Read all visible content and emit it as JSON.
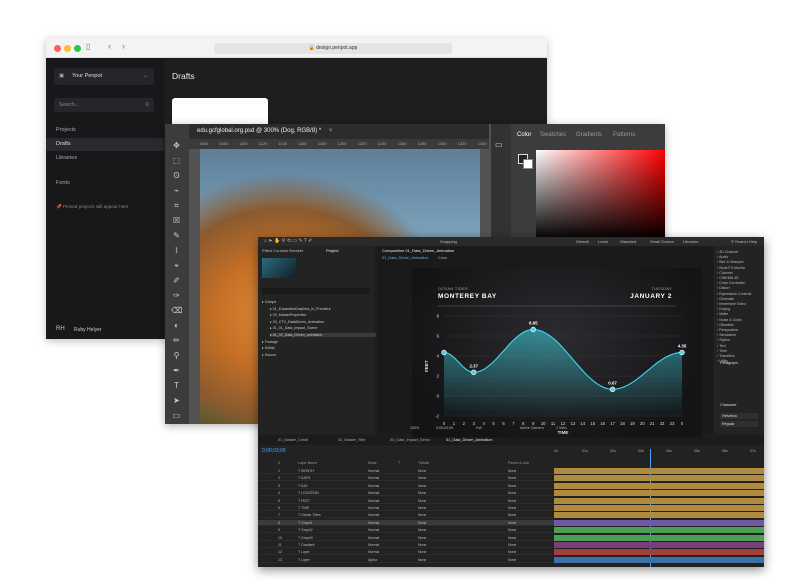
{
  "penpot": {
    "url": "design.penpot.app",
    "team": "Your Penpot",
    "search_placeholder": "Search...",
    "nav": [
      "Projects",
      "Drafts",
      "Libraries",
      "Fonts"
    ],
    "pinned_note": "Pinned projects will appear here",
    "user_initials": "RH",
    "user_name": "Ruby Helyer",
    "title": "Drafts"
  },
  "photoshop": {
    "doc_tab": "edu.gcfglobal.org.psd @ 300% (Dog, RGB/8) *",
    "ruler": "1060 1080 1100 1120 1140 1160 1180 1200 1220 1240 1260 1280 1300 1320 1340 1360",
    "panel_tabs": [
      "Color",
      "Swatches",
      "Gradients",
      "Patterns"
    ],
    "tools": [
      "✥",
      "⬚",
      "ʘ",
      "⌁",
      "⌗",
      "☒",
      "✎",
      "⌇",
      "⌖",
      "✐",
      "✑",
      "⌫",
      "◐",
      "✏",
      "⚲",
      "✒",
      "T",
      "➤",
      "▭"
    ]
  },
  "after_effects": {
    "menu": [
      "Snapping",
      "Default",
      "Learn",
      "Standard",
      "Small Screen",
      "Libraries"
    ],
    "search_help": "Search Help",
    "project_tab": "Project",
    "effect_controls": "Effect Controls Breaker",
    "comp_tab": "Composition 01_Data_Driven_Animation",
    "comp_breadcrumb": "01_Data_Driven_Animation",
    "comp_sub": "Color",
    "project_items": [
      "Comps",
      "01_ExpandedGraphics_in_Premiere",
      "02_MasterProperties",
      "03_CTV_DataDriven_Animation",
      "01_01_Data_Impact_Scene",
      "01_02_Data_Driven_animation",
      "Footage",
      "Solids",
      "Source"
    ],
    "effects_list": [
      "3D Channel",
      "Audio",
      "Blur & Sharpen",
      "Boris FX Mocha",
      "Channel",
      "CINEMA 4D",
      "Color Correction",
      "Distort",
      "Expression Controls",
      "Generate",
      "Immersive Video",
      "Keying",
      "Matte",
      "Noise & Grain",
      "Obsolete",
      "Perspective",
      "Simulation",
      "Stylize",
      "Text",
      "Time",
      "Transition",
      "Utility"
    ],
    "paragraph_label": "Paragraph",
    "character_label": "Character",
    "font_name": "Helvetica",
    "font_style": "Regular",
    "viewer_zoom": "100%",
    "viewer_time": "0;00;03;09",
    "viewer_quality": "Full",
    "viewer_camera": "Active Camera",
    "viewer_view": "1 View",
    "timecode": "0;00;03;09",
    "timeline_tabs": [
      "01_Master_Credit",
      "02_Master_Title",
      "03_Data_Impact_Demo",
      "01_Data_Driven_Animation"
    ],
    "layer_headers": [
      "#",
      "Layer Name",
      "Mode",
      "T",
      "TrkMat",
      "Parent & Link"
    ],
    "layers": [
      {
        "num": "1",
        "name": "MONTH",
        "mode": "Normal",
        "parent": "None"
      },
      {
        "num": "2",
        "name": "DAYS",
        "mode": "Normal",
        "parent": "None"
      },
      {
        "num": "3",
        "name": "DAY",
        "mode": "Normal",
        "parent": "None"
      },
      {
        "num": "4",
        "name": "LOCATION",
        "mode": "Normal",
        "parent": "None"
      },
      {
        "num": "5",
        "name": "FEET",
        "mode": "Normal",
        "parent": "None"
      },
      {
        "num": "6",
        "name": "TIME",
        "mode": "Normal",
        "parent": "None"
      },
      {
        "num": "7",
        "name": "Ocean Tides",
        "mode": "Normal",
        "parent": "None"
      },
      {
        "num": "8",
        "name": "Graph1",
        "mode": "Normal",
        "parent": "None"
      },
      {
        "num": "9",
        "name": "Graph2",
        "mode": "Normal",
        "parent": "None"
      },
      {
        "num": "10",
        "name": "Graph3",
        "mode": "Normal",
        "parent": "None"
      },
      {
        "num": "11",
        "name": "Gradient",
        "mode": "Normal",
        "parent": "None"
      },
      {
        "num": "12",
        "name": "Layer",
        "mode": "Normal",
        "parent": "None"
      },
      {
        "num": "13",
        "name": "Layer",
        "mode": "Alpha",
        "parent": "None"
      }
    ],
    "ruler_ticks": [
      "0s",
      "01s",
      "02s",
      "03s",
      "04s",
      "05s",
      "06s",
      "07s"
    ]
  },
  "chart_data": {
    "type": "area",
    "header_left_small": "OCEAN TIDES",
    "header_left": "MONTEREY BAY",
    "header_right_small": "TUESDAY",
    "header_right": "JANUARY 2",
    "xlabel": "TIME",
    "ylabel": "FEET",
    "x_ticks": [
      0,
      1,
      2,
      3,
      4,
      5,
      6,
      7,
      8,
      9,
      10,
      11,
      12,
      13,
      14,
      15,
      16,
      17,
      18,
      19,
      20,
      21,
      22,
      23,
      0
    ],
    "y_ticks": [
      -2,
      0,
      2,
      4,
      6,
      8
    ],
    "ylim": [
      -2,
      8
    ],
    "points": [
      {
        "x": 0,
        "y": 4.35
      },
      {
        "x": 3,
        "y": 2.37
      },
      {
        "x": 9,
        "y": 6.65
      },
      {
        "x": 17,
        "y": 0.67
      },
      {
        "x": 24,
        "y": 4.35
      }
    ],
    "labels": [
      "2.37",
      "6.65",
      "0.67",
      "4.35"
    ],
    "accent": "#3fd8e8"
  }
}
